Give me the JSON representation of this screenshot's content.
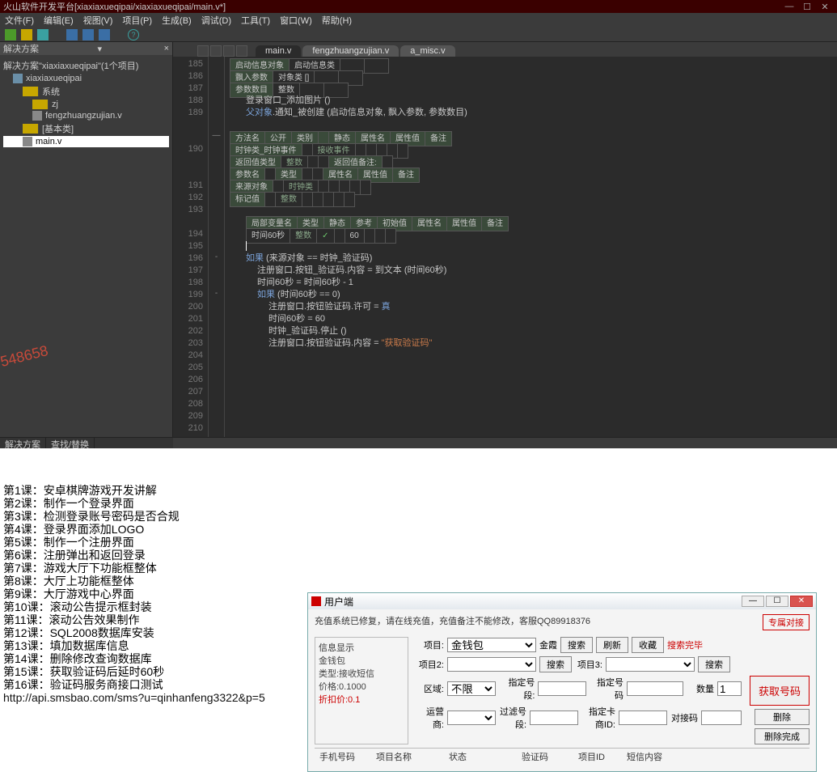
{
  "titlebar": {
    "title": "火山软件开发平台[xiaxiaxueqipai/xiaxiaxueqipai/main.v*]"
  },
  "menubar": [
    "文件(F)",
    "编辑(E)",
    "视图(V)",
    "项目(P)",
    "生成(B)",
    "调试(D)",
    "工具(T)",
    "窗口(W)",
    "帮助(H)"
  ],
  "sol": {
    "header": "解决方案",
    "root": "解决方案\"xiaxiaxueqipai\"(1个项目)",
    "proj": "xiaxiaxueqipai",
    "n_system": "系统",
    "n_zj": "zj",
    "n_fz": "fengzhuangzujian.v",
    "n_base": "[基本类]",
    "n_main": "main.v",
    "tab1": "解决方案",
    "tab2": "查找/替换"
  },
  "tabs": [
    "main.v",
    "fengzhuangzujian.v",
    "a_misc.v"
  ],
  "gutter": {
    "start": 185
  },
  "t1": {
    "r1c1": "启动信息对象",
    "r1c2": "启动信息类",
    "r2c1": "飘入参数",
    "r2c2": "对象类 []",
    "r3c1": "参数数目",
    "r3c2": "整数"
  },
  "l188": "登录窗口_添加图片 ()",
  "l189a": "父对象",
  "l189b": ".通知_被创建 (启动信息对象, 飘入参数, 参数数目)",
  "t2": {
    "h": [
      "方法名",
      "公开",
      "类别",
      "",
      "静态",
      "属性名",
      "属性值",
      "备注"
    ],
    "r1": [
      "时钟类_时钟事件",
      "",
      "接收事件",
      "",
      "",
      "",
      "",
      ""
    ],
    "r2a": "返回值类型",
    "r2b": "整数",
    "r2c": "返回值备注:",
    "r3": [
      "参数名",
      "",
      "类型",
      "",
      "",
      "属性名",
      "属性值",
      "备注"
    ],
    "r4": [
      "来源对象",
      "",
      "时钟类",
      "",
      "",
      "",
      "",
      ""
    ],
    "r5": [
      "标记值",
      "",
      "整数",
      "",
      "",
      "",
      "",
      ""
    ]
  },
  "t3": {
    "h": [
      "局部变量名",
      "类型",
      "静态",
      "参考",
      "初始值",
      "属性名",
      "属性值",
      "备注"
    ],
    "r": [
      "时间60秒",
      "整数",
      "✓",
      "",
      "60",
      "",
      "",
      ""
    ]
  },
  "code": {
    "l196a": "如果",
    "l196b": " (来源对象 == 时钟_验证码)",
    "l197": "注册窗口.按钮_验证码.内容 = 到文本 (时间60秒)",
    "l198": "时间60秒 = 时间60秒 - 1",
    "l199a": "如果",
    "l199b": " (时间60秒 == 0)",
    "l200a": "注册窗口.按钮验证码.许可 = ",
    "l200b": "真",
    "l201": "时间60秒 = 60",
    "l202": "时钟_验证码.停止 ()",
    "l203a": "注册窗口.按钮验证码.内容 = ",
    "l203b": "\"获取验证码\""
  },
  "watermark": "548658",
  "lessons": [
    "第1课：安卓棋牌游戏开发讲解",
    "第2课：制作一个登录界面",
    "第3课：检测登录账号密码是否合规",
    "第4课：登录界面添加LOGO",
    "第5课：制作一个注册界面",
    "第6课：注册弹出和返回登录",
    "第7课：游戏大厅下功能框整体",
    "第8课：大厅上功能框整体",
    "第9课：大厅游戏中心界面",
    "第10课：滚动公告提示框封装",
    "第11课：滚动公告效果制作",
    "第12课：SQL2008数据库安装",
    "第13课：填加数据库信息",
    "第14课：删除修改查询数据库",
    "第15课：获取验证码后延时60秒",
    "第16课：验证码服务商接口测试"
  ],
  "url": "http://api.smsbao.com/sms?u=qinhanfeng3322&p=5",
  "app": {
    "title": "用户端",
    "notice": "充值系统已修复，请在线充值，充值备注不能修改，客服QQ89918376",
    "right_btn": "专属对接",
    "info": {
      "h": "信息显示",
      "l1": "金钱包",
      "l2": "类型:接收短信",
      "l3": "价格:0.1000",
      "l4": "折扣价:0.1"
    },
    "labels": {
      "proj": "项目:",
      "proj2": "项目2:",
      "proj3": "项目3:",
      "area": "区域:",
      "carrier": "运营商:",
      "spec": "指定号段:",
      "spec2": "指定号码",
      "qty": "数量",
      "exclude": "过滤号段:",
      "card": "指定卡商ID:",
      "pair": "对接码"
    },
    "values": {
      "proj": "金钱包",
      "area": "不限",
      "qty": "1",
      "proj_hint": "金霞",
      "search_done": "搜索完毕"
    },
    "btns": {
      "search": "搜索",
      "refresh": "刷新",
      "fav": "收藏",
      "get": "获取号码",
      "del": "删除",
      "done": "删除完成"
    },
    "cols": [
      "手机号码",
      "项目名称",
      "状态",
      "验证码",
      "项目ID",
      "短信内容"
    ]
  }
}
